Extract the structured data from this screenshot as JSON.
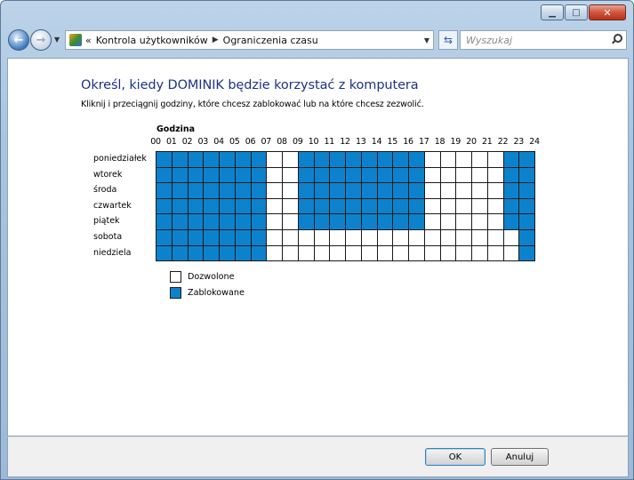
{
  "window": {
    "buttons": [
      "minimize",
      "maximize",
      "close"
    ]
  },
  "navigation": {
    "breadcrumb_prefix": "«",
    "breadcrumb": [
      "Kontrola użytkowników",
      "Ograniczenia czasu"
    ],
    "search_placeholder": "Wyszukaj",
    "back_icon": "back-arrow-icon",
    "forward_icon": "forward-arrow-icon",
    "refresh_icon": "refresh-icon",
    "search_icon": "search-icon"
  },
  "page": {
    "heading": "Określ, kiedy DOMINIK będzie korzystać z komputera",
    "instruction": "Kliknij i przeciągnij godziny, które chcesz zablokować lub na które chcesz zezwolić.",
    "hours_title": "Godzina"
  },
  "schedule": {
    "hour_labels": [
      "00",
      "01",
      "02",
      "03",
      "04",
      "05",
      "06",
      "07",
      "08",
      "09",
      "10",
      "11",
      "12",
      "13",
      "14",
      "15",
      "16",
      "17",
      "18",
      "19",
      "20",
      "21",
      "22",
      "23",
      "24"
    ],
    "days": [
      {
        "name": "poniedziałek",
        "blocked_hours": [
          0,
          1,
          2,
          3,
          4,
          5,
          6,
          9,
          10,
          11,
          12,
          13,
          14,
          15,
          16,
          22,
          23
        ]
      },
      {
        "name": "wtorek",
        "blocked_hours": [
          0,
          1,
          2,
          3,
          4,
          5,
          6,
          9,
          10,
          11,
          12,
          13,
          14,
          15,
          16,
          22,
          23
        ]
      },
      {
        "name": "środa",
        "blocked_hours": [
          0,
          1,
          2,
          3,
          4,
          5,
          6,
          9,
          10,
          11,
          12,
          13,
          14,
          15,
          16,
          22,
          23
        ]
      },
      {
        "name": "czwartek",
        "blocked_hours": [
          0,
          1,
          2,
          3,
          4,
          5,
          6,
          9,
          10,
          11,
          12,
          13,
          14,
          15,
          16,
          22,
          23
        ]
      },
      {
        "name": "piątek",
        "blocked_hours": [
          0,
          1,
          2,
          3,
          4,
          5,
          6,
          9,
          10,
          11,
          12,
          13,
          14,
          15,
          16,
          22,
          23
        ]
      },
      {
        "name": "sobota",
        "blocked_hours": [
          0,
          1,
          2,
          3,
          4,
          5,
          6,
          23
        ]
      },
      {
        "name": "niedziela",
        "blocked_hours": [
          0,
          1,
          2,
          3,
          4,
          5,
          6,
          23
        ]
      }
    ],
    "colors": {
      "blocked": "#0d82cc",
      "allowed": "#ffffff"
    }
  },
  "legend": {
    "allowed": "Dozwolone",
    "blocked": "Zablokowane"
  },
  "footer": {
    "ok": "OK",
    "cancel": "Anuluj"
  }
}
